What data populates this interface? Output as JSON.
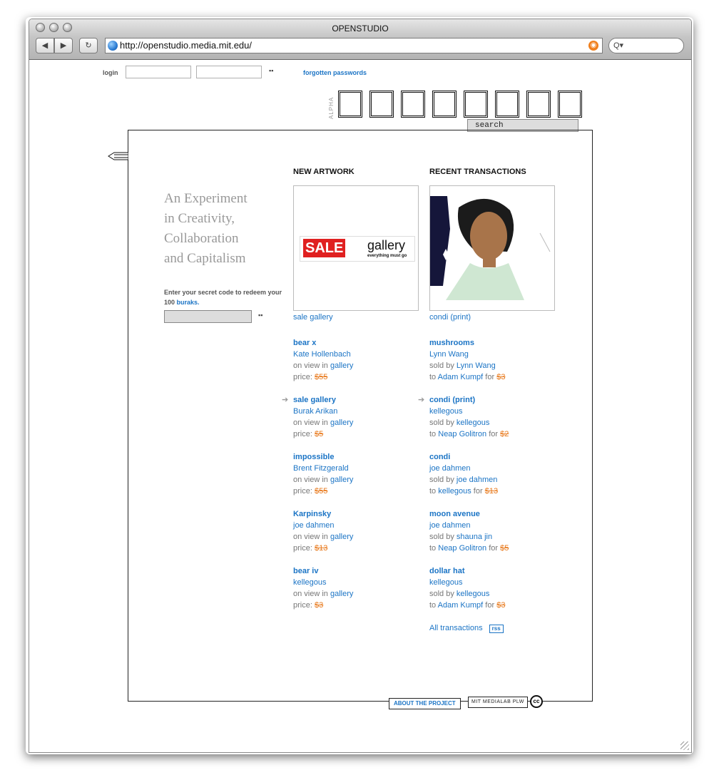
{
  "browser": {
    "title": "OPENSTUDIO",
    "url": "http://openstudio.media.mit.edu/",
    "back_label": "◀",
    "forward_label": "▶",
    "reload_label": "↻",
    "search_placeholder": "Q▾"
  },
  "topbar": {
    "login_label": "login",
    "forgot_label": "forgotten passwords",
    "logo_side": "ALPHA",
    "search_label": "search"
  },
  "left": {
    "tagline": [
      "An Experiment",
      "in Creativity,",
      "Collaboration",
      "and Capitalism"
    ],
    "secret_text": "Enter your secret code to redeem your 100",
    "secret_link": "buraks."
  },
  "new_artwork": {
    "heading": "NEW ARTWORK",
    "feature_caption": "sale gallery",
    "feature_art": {
      "big": "SALE",
      "word": "gallery",
      "sub": "everything must go"
    },
    "items": [
      {
        "title": "bear x",
        "artist": "Kate Hollenbach",
        "view_prefix": "on view in",
        "view_link": "gallery",
        "price_label": "price:",
        "price": "$55",
        "arrow": false
      },
      {
        "title": "sale gallery",
        "artist": "Burak Arikan",
        "view_prefix": "on view in",
        "view_link": "gallery",
        "price_label": "price:",
        "price": "$5",
        "arrow": true
      },
      {
        "title": "impossible",
        "artist": "Brent Fitzgerald",
        "view_prefix": "on view in",
        "view_link": "gallery",
        "price_label": "price:",
        "price": "$55",
        "arrow": false
      },
      {
        "title": "Karpinsky",
        "artist": "joe dahmen",
        "view_prefix": "on view in",
        "view_link": "gallery",
        "price_label": "price:",
        "price": "$13",
        "arrow": false
      },
      {
        "title": "bear iv",
        "artist": "kellegous",
        "view_prefix": "on view in",
        "view_link": "gallery",
        "price_label": "price:",
        "price": "$3",
        "arrow": false
      }
    ]
  },
  "transactions": {
    "heading": "RECENT TRANSACTIONS",
    "feature_caption": "condi (print)",
    "items": [
      {
        "title": "mushrooms",
        "artist": "Lynn Wang",
        "sold_prefix": "sold by",
        "seller": "Lynn Wang",
        "to_prefix": "to",
        "buyer": "Adam Kumpf",
        "for_label": "for",
        "price": "$3",
        "arrow": false
      },
      {
        "title": "condi (print)",
        "artist": "kellegous",
        "sold_prefix": "sold by",
        "seller": "kellegous",
        "to_prefix": "to",
        "buyer": "Neap Golitron",
        "for_label": "for",
        "price": "$2",
        "arrow": true
      },
      {
        "title": "condi",
        "artist": "joe dahmen",
        "sold_prefix": "sold by",
        "seller": "joe dahmen",
        "to_prefix": "to",
        "buyer": "kellegous",
        "for_label": "for",
        "price": "$13",
        "arrow": false
      },
      {
        "title": "moon avenue",
        "artist": "joe dahmen",
        "sold_prefix": "sold by",
        "seller": "shauna jin",
        "to_prefix": "to",
        "buyer": "Neap Golitron",
        "for_label": "for",
        "price": "$5",
        "arrow": false
      },
      {
        "title": "dollar hat",
        "artist": "kellegous",
        "sold_prefix": "sold by",
        "seller": "kellegous",
        "to_prefix": "to",
        "buyer": "Adam Kumpf",
        "for_label": "for",
        "price": "$3",
        "arrow": false
      }
    ],
    "all_label": "All transactions",
    "rss_label": "rss"
  },
  "footer": {
    "about_label": "ABOUT THE PROJECT",
    "mit_label": "MIT MEDIALAB PLW",
    "cc_label": "cc"
  }
}
